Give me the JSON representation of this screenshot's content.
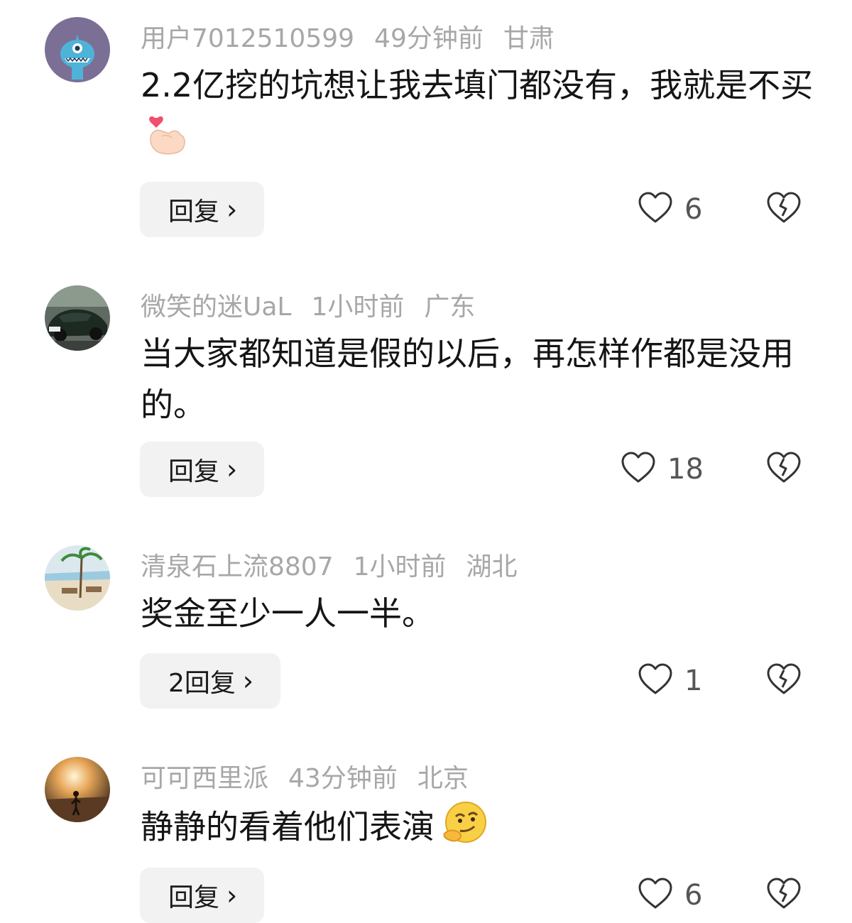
{
  "comments": [
    {
      "username": "用户7012510599",
      "time": "49分钟前",
      "location": "甘肃",
      "text": "2.2亿挖的坑想让我去填门都没有，我就是不买",
      "emoji_icon": "finger-heart-emoji",
      "reply_label": "回复",
      "likes": "6"
    },
    {
      "username": "微笑的迷UaL",
      "time": "1小时前",
      "location": "广东",
      "text": "当大家都知道是假的以后，再怎样作都是没用的。",
      "reply_label": "回复",
      "likes": "18"
    },
    {
      "username": "清泉石上流8807",
      "time": "1小时前",
      "location": "湖北",
      "text": "奖金至少一人一半。",
      "reply_label": "2回复",
      "likes": "1"
    },
    {
      "username": "可可西里派",
      "time": "43分钟前",
      "location": "北京",
      "text": "静静的看着他们表演",
      "emoji_icon": "thinking-smirk-emoji",
      "reply_label": "回复",
      "likes": "6"
    }
  ],
  "icons": {
    "like": "heart-outline-icon",
    "dislike": "broken-heart-icon",
    "reply_chevron": "chevron-right-icon"
  },
  "colors": {
    "meta_text": "#a7a7a7",
    "reply_bg": "#f2f2f2",
    "icon_stroke": "#333333"
  }
}
